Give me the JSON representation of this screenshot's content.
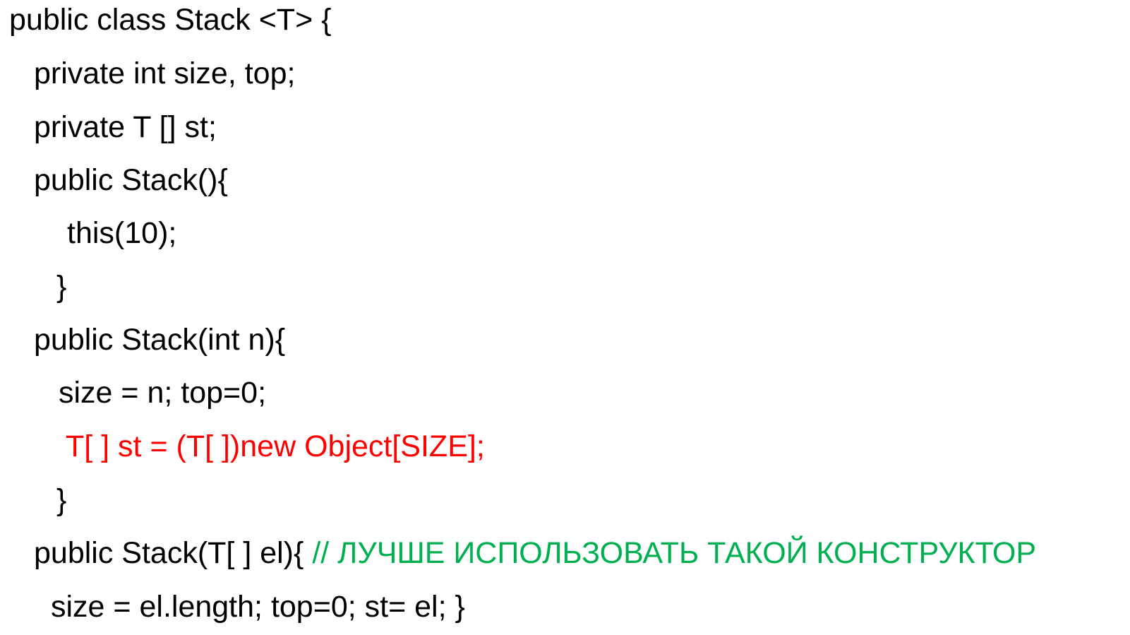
{
  "code": {
    "line1": "public class Stack <T> {",
    "line2": "private int size, top;",
    "line3": "private T [] st;",
    "line4": "public Stack(){",
    "line5": "this(10);",
    "line6": "}",
    "line7": "public Stack(int n){",
    "line8": "size = n; top=0;",
    "line9": "T[ ] st = (T[ ])new Object[SIZE];",
    "line10": "}",
    "line11_code": "public Stack(T[ ] el){ ",
    "line11_comment": "// ЛУЧШЕ ИСПОЛЬЗОВАТЬ ТАКОЙ КОНСТРУКТОР",
    "line12": "size = el.length; top=0; st= el; }"
  },
  "colors": {
    "text": "#000000",
    "error_line": "#ff0000",
    "comment": "#00b050",
    "background": "#ffffff"
  }
}
